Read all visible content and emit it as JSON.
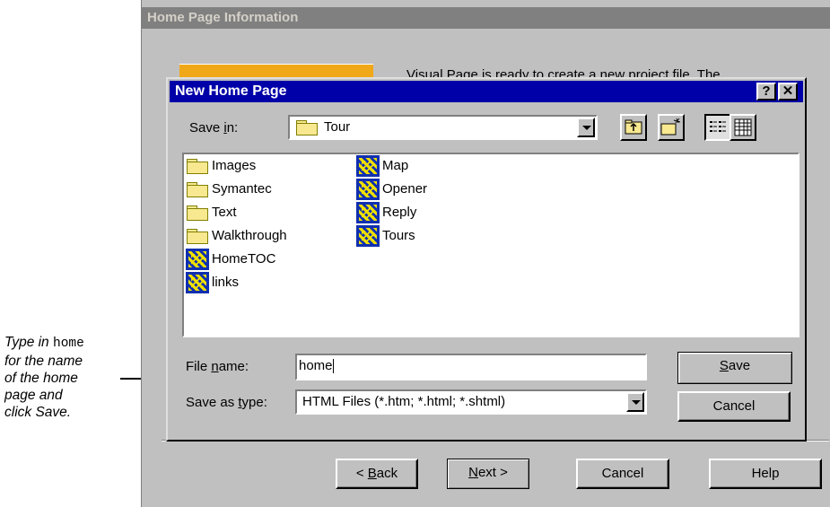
{
  "callout": {
    "line1_prefix": "Type in",
    "line1_code": "home",
    "line2": "for the name",
    "line3": "of the home",
    "line4": "page and",
    "line5": "click Save."
  },
  "wizard": {
    "title": "Home Page Information",
    "intro_text": "Visual Page is ready to create a new project file. The",
    "buttons": {
      "back": {
        "prefix": "< ",
        "mnemonic": "B",
        "rest": "ack"
      },
      "next": {
        "mnemonic": "N",
        "rest": "ext >"
      },
      "cancel": "Cancel",
      "help": "Help"
    }
  },
  "dialog": {
    "title": "New Home Page",
    "help_glyph": "?",
    "close_glyph": "✕",
    "save_in": {
      "label_prefix": "Save ",
      "label_mnemonic": "i",
      "label_rest": "n:",
      "value": "Tour"
    },
    "files": [
      {
        "name": "Images",
        "icon": "folder-icon"
      },
      {
        "name": "Symantec",
        "icon": "folder-icon"
      },
      {
        "name": "Text",
        "icon": "folder-icon"
      },
      {
        "name": "Walkthrough",
        "icon": "folder-icon"
      },
      {
        "name": "HomeTOC",
        "icon": "page-file-icon"
      },
      {
        "name": "links",
        "icon": "page-file-icon"
      },
      {
        "name": "Map",
        "icon": "page-file-icon"
      },
      {
        "name": "Opener",
        "icon": "page-file-icon"
      },
      {
        "name": "Reply",
        "icon": "page-file-icon"
      },
      {
        "name": "Tours",
        "icon": "page-file-icon"
      }
    ],
    "file_name": {
      "label_prefix": "File ",
      "label_mnemonic": "n",
      "label_rest": "ame:",
      "value": "home"
    },
    "save_as_type": {
      "label_prefix": "Save as ",
      "label_mnemonic": "t",
      "label_rest": "ype:",
      "value": "HTML Files (*.htm; *.html; *.shtml)"
    },
    "save_button": {
      "mnemonic": "S",
      "rest": "ave"
    },
    "cancel_button": "Cancel"
  }
}
